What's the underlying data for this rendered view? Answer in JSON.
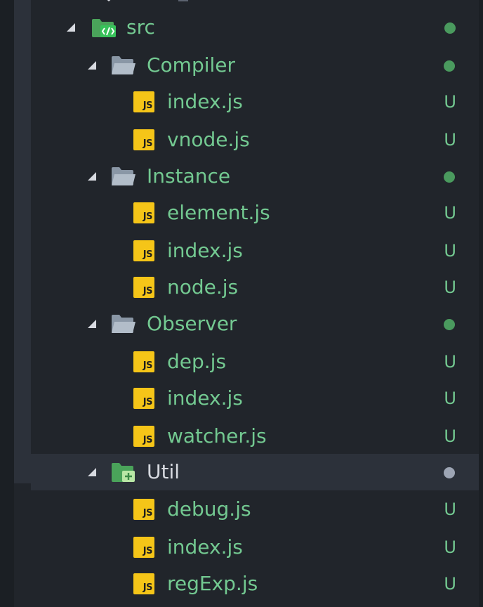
{
  "explorer": {
    "root": {
      "label": "src",
      "icon": "src-folder-icon",
      "status": "modified-dot",
      "colors": {
        "label": "#73c991",
        "dot": "#4a9a5e"
      }
    },
    "folders": [
      {
        "label": "Compiler",
        "status": "modified-dot",
        "files": [
          {
            "name": "index.js",
            "status": "U"
          },
          {
            "name": "vnode.js",
            "status": "U"
          }
        ]
      },
      {
        "label": "Instance",
        "status": "modified-dot",
        "files": [
          {
            "name": "element.js",
            "status": "U"
          },
          {
            "name": "index.js",
            "status": "U"
          },
          {
            "name": "node.js",
            "status": "U"
          }
        ]
      },
      {
        "label": "Observer",
        "status": "modified-dot",
        "files": [
          {
            "name": "dep.js",
            "status": "U"
          },
          {
            "name": "index.js",
            "status": "U"
          },
          {
            "name": "watcher.js",
            "status": "U"
          }
        ]
      },
      {
        "label": "Util",
        "status": "selected-dot",
        "files": [
          {
            "name": "debug.js",
            "status": "U"
          },
          {
            "name": "index.js",
            "status": "U"
          },
          {
            "name": "regExp.js",
            "status": "U"
          }
        ]
      }
    ],
    "js_badge": "JS"
  }
}
